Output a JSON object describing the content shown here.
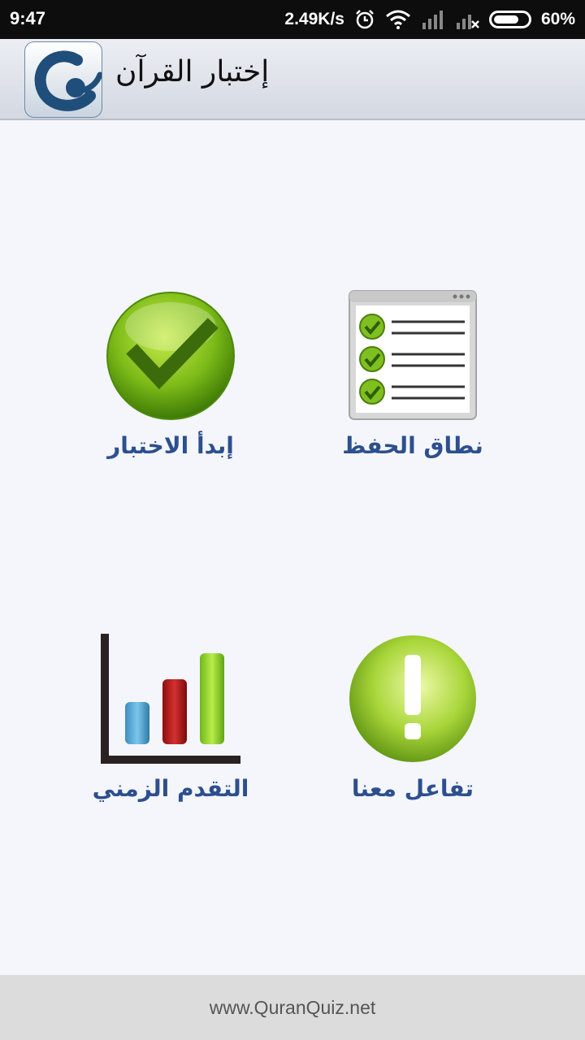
{
  "status_bar": {
    "time": "9:47",
    "network_speed": "2.49K/s",
    "battery": "60%",
    "icons": [
      "alarm-icon",
      "wifi-icon",
      "signal-icon",
      "signal-no-sim-icon",
      "battery-icon"
    ]
  },
  "app_bar": {
    "title": "إختبار القرآن",
    "logo_icon": "quran-quiz-logo-icon"
  },
  "menu": {
    "start_quiz": {
      "label": "إبدأ الاختبار",
      "icon": "checkmark-icon",
      "color": "#6fae1c"
    },
    "memorization_range": {
      "label": "نطاق الحفظ",
      "icon": "checklist-icon"
    },
    "progress": {
      "label": "التقدم الزمني",
      "icon": "bar-chart-icon"
    },
    "contact": {
      "label": "تفاعل معنا",
      "icon": "exclamation-icon"
    },
    "label_color": "#2d4f8e"
  },
  "footer": {
    "website": "www.QuranQuiz.net"
  }
}
